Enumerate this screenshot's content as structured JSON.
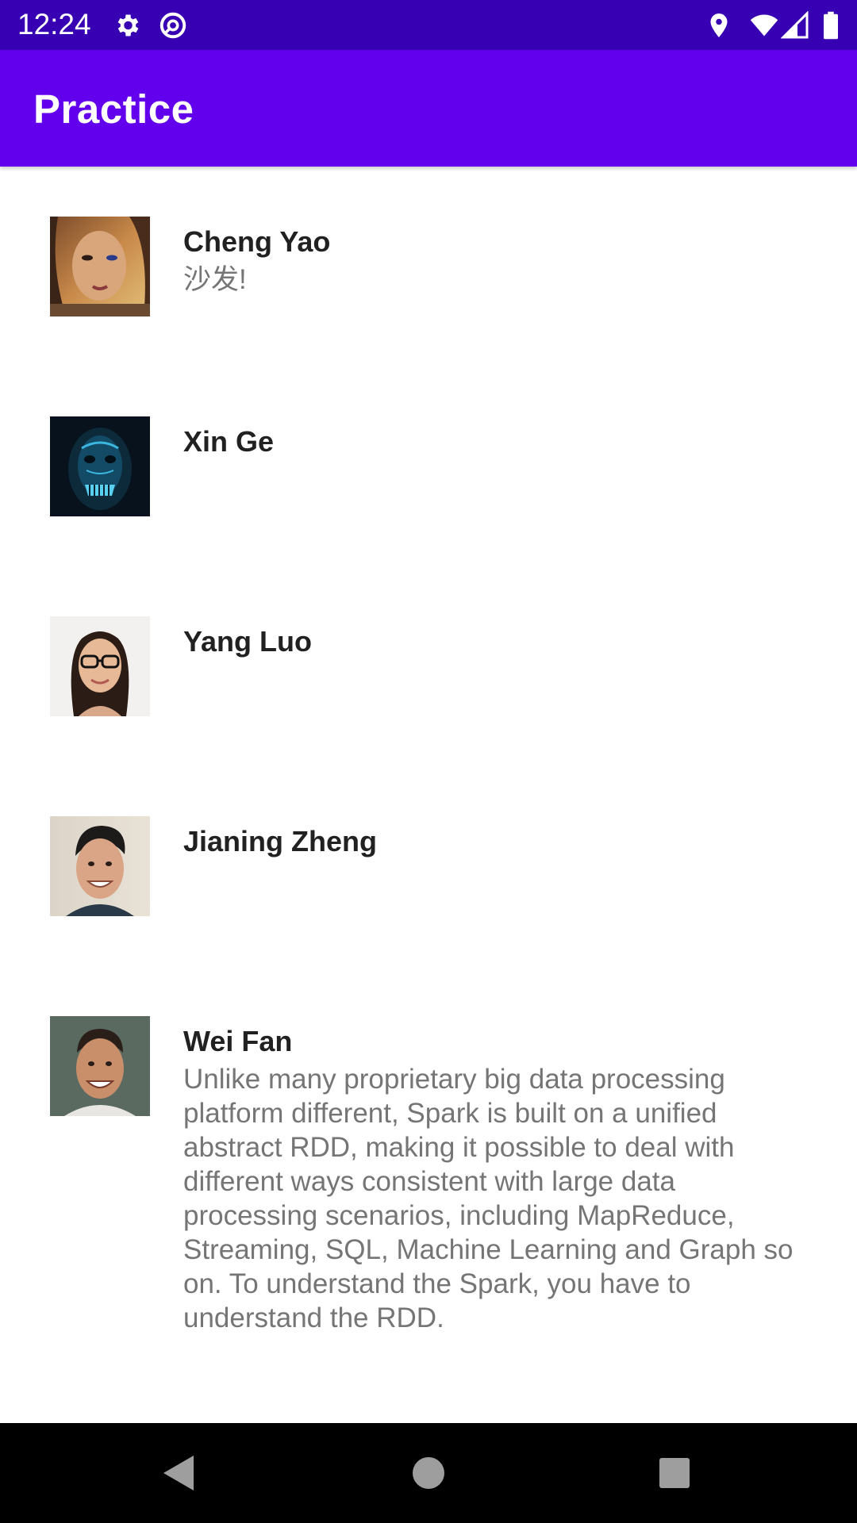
{
  "status_bar": {
    "time": "12:24",
    "left_icons": [
      "settings-icon",
      "at-sign-icon"
    ],
    "right_icons": [
      "location-icon",
      "wifi-icon",
      "signal-icon",
      "battery-icon"
    ],
    "background": "#3700b3"
  },
  "app_bar": {
    "title": "Practice",
    "background": "#6200ee"
  },
  "list": {
    "items": [
      {
        "name": "Cheng Yao",
        "message": "沙发!"
      },
      {
        "name": "Xin Ge",
        "message": ""
      },
      {
        "name": "Yang Luo",
        "message": ""
      },
      {
        "name": "Jianing Zheng",
        "message": ""
      },
      {
        "name": "Wei Fan",
        "message": "Unlike many proprietary big data processing platform different, Spark is built on a unified abstract RDD, making it possible to deal with different ways consistent with large data processing scenarios, including MapReduce, Streaming, SQL, Machine Learning and Graph so on. To understand the Spark, you have to understand the RDD."
      }
    ]
  },
  "nav_bar": {
    "buttons": [
      "back-icon",
      "home-icon",
      "recents-icon"
    ]
  }
}
